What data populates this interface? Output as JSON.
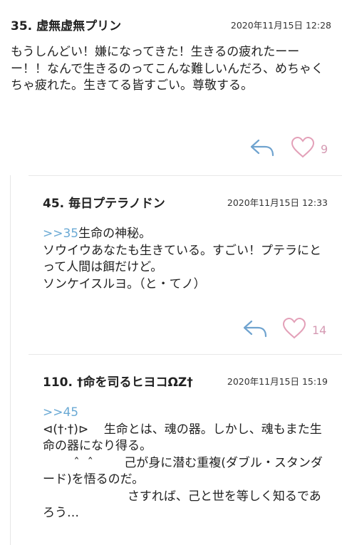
{
  "posts": [
    {
      "num": "35.",
      "name": "虚無虚無プリン",
      "date": "2020年11月15日 12:28",
      "anchor": "",
      "body": "もうしんどい！嫌になってきた！生きるの疲れたーーー！！なんで生きるのってこんな難しいんだろ、めちゃくちゃ疲れた。生きてる皆すごい。尊敬する。",
      "likes": "9"
    },
    {
      "num": "45.",
      "name": "毎日プテラノドン",
      "date": "2020年11月15日 12:33",
      "anchor": ">>35",
      "body": "生命の神秘。\nソウイウあなたも生きている。すごい！プテラにとって人間は餌だけど。\nソンケイスルヨ。（と・てノ）",
      "likes": "14"
    },
    {
      "num": "110.",
      "name": "†命を司るヒヨコΩZ†",
      "date": "2020年11月15日 15:19",
      "anchor": ">>45",
      "body": "⊲(†·†)⊳    生命とは、魂の器。しかし、魂もまた生命の器になり得る。\n        ˆ  ˆ        己が身に潜む重複(ダブル・スタンダード)を悟るのだ。\n                      さすれば、己と世を等しく知るであろう…",
      "likes": ""
    }
  ],
  "colors": {
    "anchor": "#6aa9d4",
    "reply_icon": "#6fa3cf",
    "heart_icon": "#e3a0b8",
    "count": "#d59ab3"
  }
}
